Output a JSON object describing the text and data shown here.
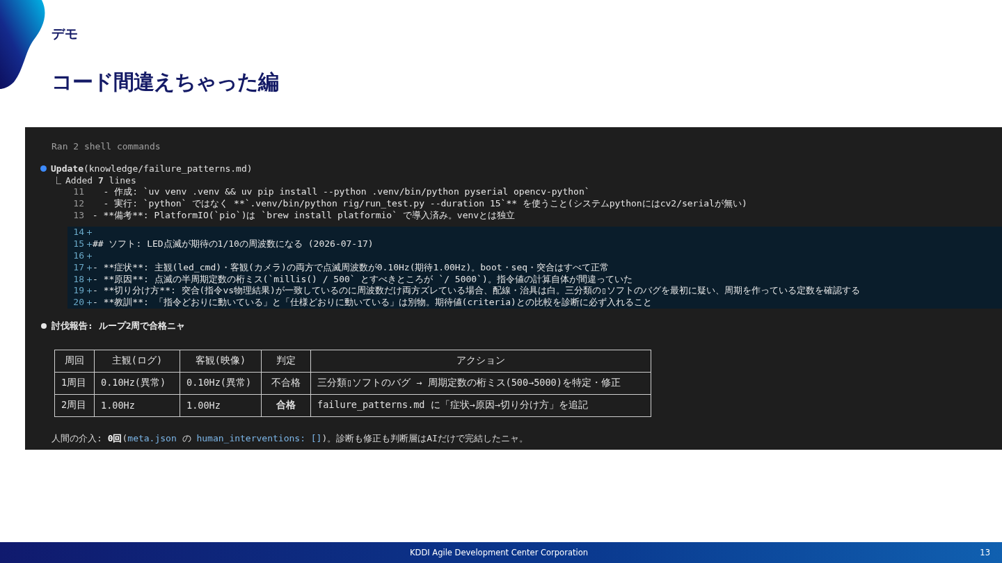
{
  "slide": {
    "section": "デモ",
    "title": "コード間違えちゃった編",
    "footer": "KDDI Agile Development Center Corporation",
    "page": "13"
  },
  "terminal": {
    "status": "Ran 2 shell commands",
    "update": {
      "text": "**Update**(knowledge/failure_patterns.md)",
      "summary": "Added **7** lines"
    },
    "diff": [
      {
        "num": "11",
        "kind": "context",
        "text": "   - 作成: `uv venv .venv && uv pip install --python .venv/bin/python pyserial opencv-python`"
      },
      {
        "num": "12",
        "kind": "context",
        "text": "   - 実行: `python` ではなく **`.venv/bin/python rig/run_test.py --duration 15`** を使うこと(システムpythonにはcv2/serialが無い)"
      },
      {
        "num": "13",
        "kind": "context",
        "text": " - **備考**: PlatformIO(`pio`)は `brew install platformio` で導入済み。venvとは独立"
      },
      {
        "num": "14",
        "kind": "added"
      },
      {
        "num": "15",
        "kind": "added",
        "text": "## ソフト: LED点滅が期待の1/10の周波数になる (2026-07-17)"
      },
      {
        "num": "16",
        "kind": "added"
      },
      {
        "num": "17",
        "kind": "added",
        "text": "- **症状**: 主観(led_cmd)・客観(カメラ)の両方で点滅周波数が0.10Hz(期待1.00Hz)。boot・seq・突合はすべて正常"
      },
      {
        "num": "18",
        "kind": "added",
        "text": "- **原因**: 点滅の半周期定数の桁ミス(`millis() / 500` とすべきところが `/ 5000`)。指令値の計算自体が間違っていた"
      },
      {
        "num": "19",
        "kind": "added",
        "text": "- **切り分け方**: 突合(指令vs物理結果)が一致しているのに周波数だけ両方ズレている場合、配線・治具は白。三分類の▯ソフトのバグを最初に疑い、周期を作っている定数を確認する"
      },
      {
        "num": "20",
        "kind": "added",
        "text": "- **教訓**: 「指令どおりに動いている」と「仕様どおりに動いている」は別物。期待値(criteria)との比較を診断に必ず入れること"
      }
    ],
    "report": "討伐報告: ループ2周で合格ニャ",
    "table": {
      "columns": [
        "周回",
        "主観(ログ)",
        "客観(映像)",
        "判定",
        "アクション"
      ],
      "rows": [
        {
          "cells": [
            "1周目",
            "0.10Hz(異常)",
            "0.10Hz(異常)",
            "不合格",
            "三分類▯ソフトのバグ → 周期定数の桁ミス(500→5000)を特定・修正"
          ],
          "emphasis": false
        },
        {
          "cells": [
            "2周目",
            "1.00Hz",
            "1.00Hz",
            "合格",
            "failure_patterns.md に「症状→原因→切り分け方」を追記"
          ],
          "emphasis": true
        }
      ]
    },
    "note": [
      {
        "kind": "plain",
        "text": "人間の介入: "
      },
      {
        "kind": "bold",
        "text": "0回"
      },
      {
        "kind": "plain",
        "text": "("
      },
      {
        "kind": "code",
        "text": "meta.json"
      },
      {
        "kind": "plain",
        "text": " の "
      },
      {
        "kind": "code",
        "text": "human_interventions: []"
      },
      {
        "kind": "plain",
        "text": ")。診断も修正も判断層はAIだけで完結したニャ。"
      }
    ]
  }
}
